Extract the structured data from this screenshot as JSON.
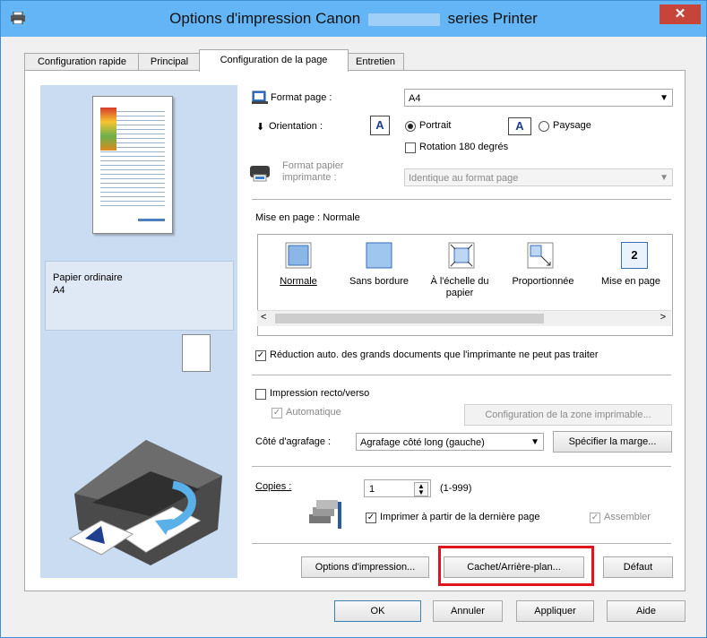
{
  "window": {
    "title_part1": "Options d'impression Canon",
    "title_part2": "series Printer",
    "close_label": "✕"
  },
  "tabs": [
    {
      "label": "Configuration rapide"
    },
    {
      "label": "Principal"
    },
    {
      "label": "Configuration de la page"
    },
    {
      "label": "Entretien"
    }
  ],
  "preview": {
    "paper_type": "Papier ordinaire",
    "paper_size": "A4"
  },
  "page_setup": {
    "format_page_label": "Format page :",
    "format_page_value": "A4",
    "orientation_label": "Orientation :",
    "orientation_glyph": "A",
    "portrait_label": "Portrait",
    "paysage_label": "Paysage",
    "rotation_label": "Rotation 180 degrés",
    "printer_paper_label_1": "Format papier",
    "printer_paper_label_2": "imprimante :",
    "printer_paper_value": "Identique au format page"
  },
  "layout": {
    "heading": "Mise en page : Normale",
    "items": [
      {
        "label": "Normale"
      },
      {
        "label": "Sans bordure"
      },
      {
        "label": "À l'échelle du papier"
      },
      {
        "label": "Proportionnée"
      },
      {
        "label": "Mise en page"
      }
    ],
    "mise_en_page_number": "2",
    "scroll_left": "<",
    "scroll_right": ">"
  },
  "reduction": {
    "label": "Réduction auto. des grands documents que l'imprimante ne peut pas traiter"
  },
  "duplex": {
    "label": "Impression recto/verso",
    "auto_label": "Automatique",
    "zone_button": "Configuration de la zone imprimable...",
    "staple_label": "Côté d'agrafage :",
    "staple_value": "Agrafage côté long (gauche)",
    "margin_button": "Spécifier la marge..."
  },
  "copies": {
    "label": "Copies :",
    "value": "1",
    "range": "(1-999)",
    "last_page_label": "Imprimer à partir de la dernière page",
    "collate_label": "Assembler"
  },
  "bottom_buttons": {
    "options": "Options d'impression...",
    "stamp": "Cachet/Arrière-plan...",
    "default": "Défaut"
  },
  "footer_buttons": {
    "ok": "OK",
    "cancel": "Annuler",
    "apply": "Appliquer",
    "help": "Aide"
  },
  "colors": {
    "titlebar": "#64b5f5",
    "close": "#c7443a",
    "highlight": "#e0141e",
    "left_panel": "#c9dcf1"
  },
  "checkmark": "✓"
}
